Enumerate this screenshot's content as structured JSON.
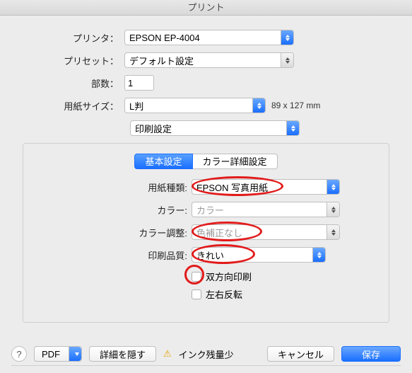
{
  "title": "プリント",
  "labels": {
    "printer": "プリンタ：",
    "preset": "プリセット：",
    "copies": "部数：",
    "paperSize": "用紙サイズ：",
    "paperType": "用紙種類:",
    "color": "カラー:",
    "colorAdjust": "カラー調整:",
    "quality": "印刷品質:",
    "bidi": "双方向印刷",
    "mirror": "左右反転"
  },
  "values": {
    "printer": "EPSON EP-4004",
    "preset": "デフォルト設定",
    "copies": "1",
    "paperSize": "L判",
    "paperSizeNote": "89 x 127 mm",
    "section": "印刷設定",
    "paperType": "EPSON 写真用紙",
    "color": "カラー",
    "colorAdjust": "色補正なし",
    "quality": "きれい"
  },
  "tabs": {
    "basic": "基本設定",
    "advanced": "カラー詳細設定"
  },
  "footer": {
    "pdf": "PDF",
    "details": "詳細を隠す",
    "warn": "インク残量少",
    "cancel": "キャンセル",
    "save": "保存"
  }
}
